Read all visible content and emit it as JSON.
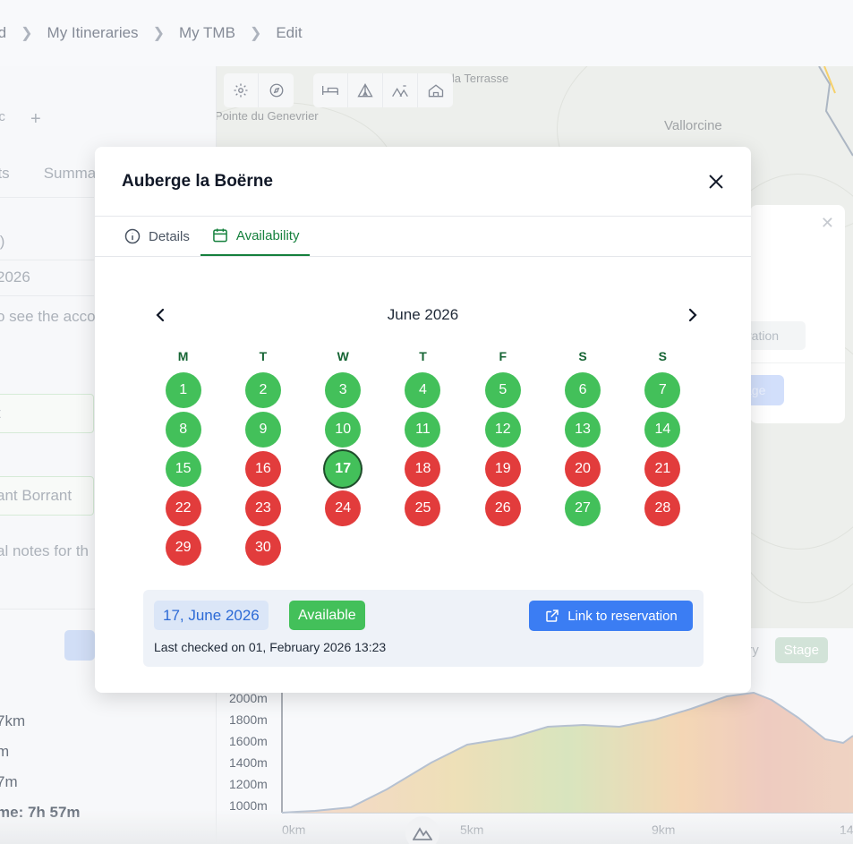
{
  "breadcrumb": {
    "items": [
      "rd",
      "My Itineraries",
      "My TMB",
      "Edit"
    ]
  },
  "left_panel": {
    "chip": "nc",
    "tabs": [
      "nts",
      "Summa"
    ],
    "lines": [
      "l)",
      " 2026",
      "o see the acco",
      "t",
      "ant Borrant",
      "al notes for th"
    ],
    "stats": [
      "7km",
      "m",
      "7m",
      "me: 7h 57m"
    ]
  },
  "map": {
    "labels": [
      "e la Terrasse",
      "Pointe du Genevrier",
      "Vallorcine"
    ],
    "tools": [
      "gear-icon",
      "compass-icon",
      "bed-icon",
      "tent-icon",
      "camp-icon",
      "hut-icon"
    ]
  },
  "side_card": {
    "reservation": "rvation",
    "stage": "age"
  },
  "profile": {
    "toggle": [
      "ry",
      "Stage"
    ],
    "y_labels": [
      "2000m",
      "1800m",
      "1600m",
      "1400m",
      "1200m",
      "1000m"
    ],
    "x_labels": [
      "0km",
      "5km",
      "9km",
      "14"
    ]
  },
  "modal": {
    "title": "Auberge la Boërne",
    "tabs": {
      "details": "Details",
      "availability": "Availability"
    },
    "calendar": {
      "month": "June 2026",
      "weekdays": [
        "M",
        "T",
        "W",
        "T",
        "F",
        "S",
        "S"
      ],
      "days": [
        {
          "d": "1",
          "s": "av"
        },
        {
          "d": "2",
          "s": "av"
        },
        {
          "d": "3",
          "s": "av"
        },
        {
          "d": "4",
          "s": "av"
        },
        {
          "d": "5",
          "s": "av"
        },
        {
          "d": "6",
          "s": "av"
        },
        {
          "d": "7",
          "s": "av"
        },
        {
          "d": "8",
          "s": "av"
        },
        {
          "d": "9",
          "s": "av"
        },
        {
          "d": "10",
          "s": "av"
        },
        {
          "d": "11",
          "s": "av"
        },
        {
          "d": "12",
          "s": "av"
        },
        {
          "d": "13",
          "s": "av"
        },
        {
          "d": "14",
          "s": "av"
        },
        {
          "d": "15",
          "s": "av"
        },
        {
          "d": "16",
          "s": "un"
        },
        {
          "d": "17",
          "s": "av",
          "selected": true
        },
        {
          "d": "18",
          "s": "un"
        },
        {
          "d": "19",
          "s": "un"
        },
        {
          "d": "20",
          "s": "un"
        },
        {
          "d": "21",
          "s": "un"
        },
        {
          "d": "22",
          "s": "un"
        },
        {
          "d": "23",
          "s": "un"
        },
        {
          "d": "24",
          "s": "un"
        },
        {
          "d": "25",
          "s": "un"
        },
        {
          "d": "26",
          "s": "un"
        },
        {
          "d": "27",
          "s": "av"
        },
        {
          "d": "28",
          "s": "un"
        },
        {
          "d": "29",
          "s": "un"
        },
        {
          "d": "30",
          "s": "un"
        }
      ]
    },
    "selection": {
      "date": "17, June 2026",
      "status": "Available",
      "link_label": "Link to reservation",
      "last_checked": "Last checked on 01, February 2026 13:23"
    }
  },
  "colors": {
    "available": "#43c05a",
    "unavailable": "#e23c3c",
    "accent": "#15803d",
    "link": "#3b7df3"
  }
}
